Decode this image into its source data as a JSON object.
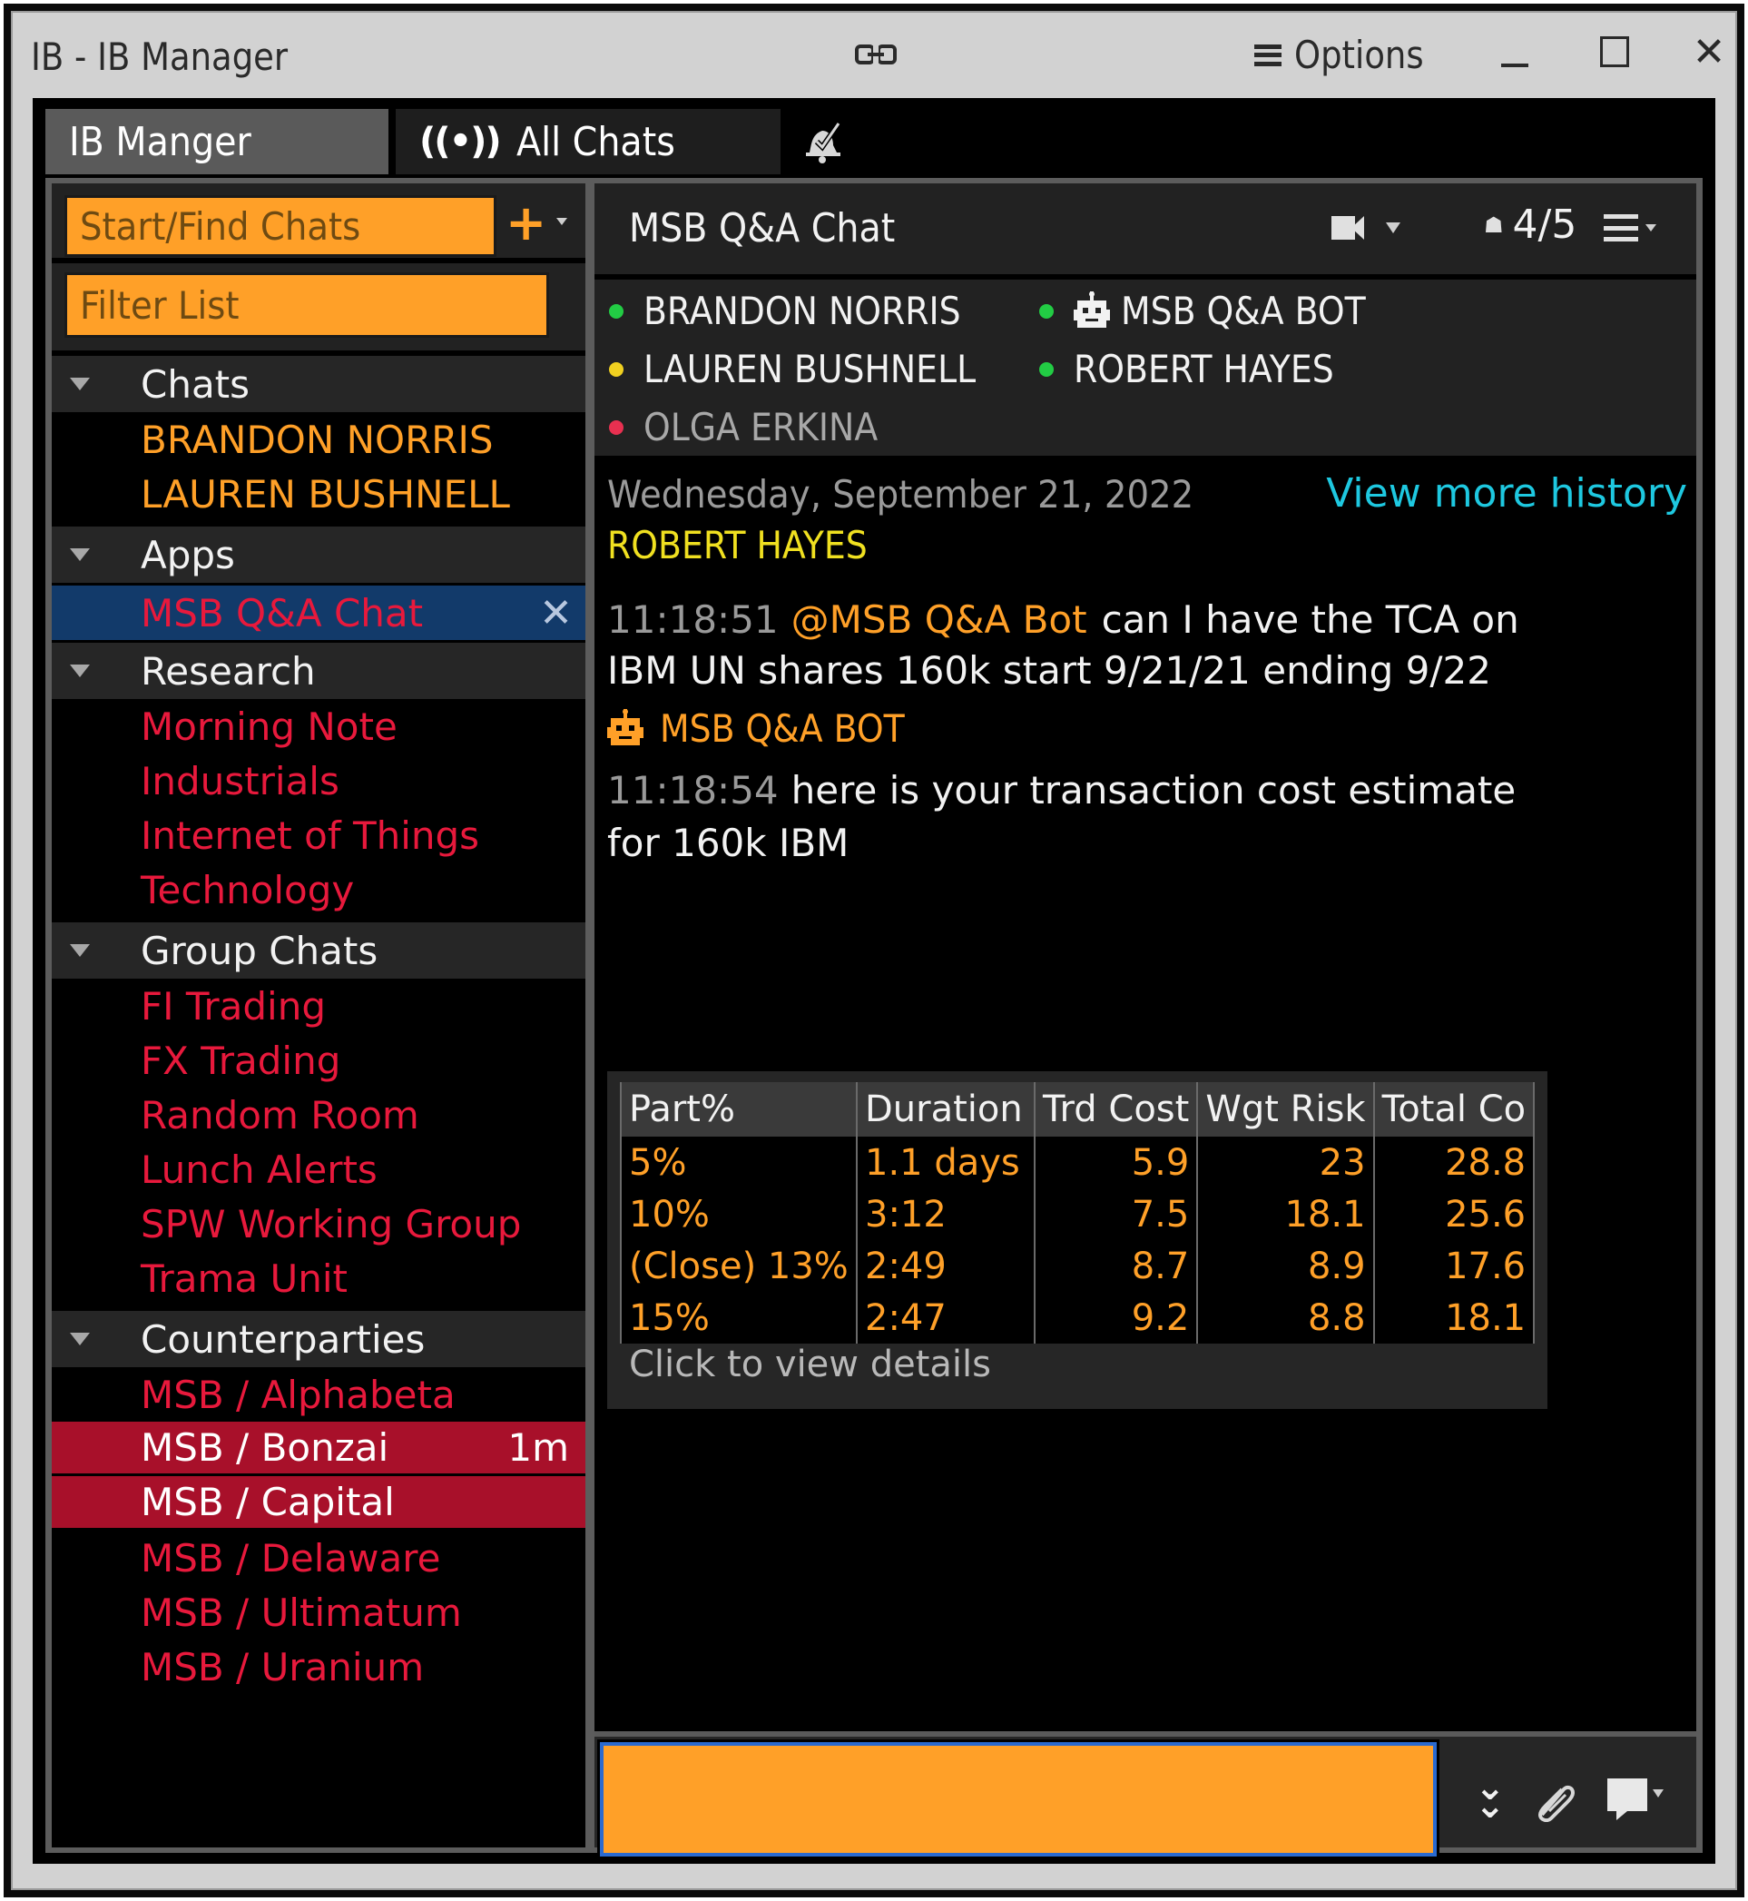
{
  "window": {
    "title": "IB - IB Manager",
    "options_label": "Options",
    "link_icon": "link-icon",
    "minimize_icon": "minimize-icon",
    "maximize_icon": "maximize-icon",
    "close_icon": "close-icon"
  },
  "tabs": [
    {
      "label": "IB Manger",
      "active": true
    },
    {
      "label": "All Chats",
      "icon": "broadcast-icon",
      "icon_glyph": "((•))"
    },
    {
      "label": "",
      "icon": "bell-check-icon"
    }
  ],
  "sidebar": {
    "search_placeholder": "Start/Find Chats",
    "add_label": "+",
    "filter_placeholder": "Filter List",
    "groups": [
      {
        "label": "Chats",
        "items": [
          {
            "label": "BRANDON NORRIS",
            "style": "orange"
          },
          {
            "label": "LAUREN BUSHNELL",
            "style": "orange"
          }
        ]
      },
      {
        "label": "Apps",
        "items": [
          {
            "label": "MSB Q&A Chat",
            "style": "selected",
            "close": "✕"
          }
        ]
      },
      {
        "label": "Research",
        "items": [
          {
            "label": "Morning Note",
            "style": "red"
          },
          {
            "label": "Industrials",
            "style": "red"
          },
          {
            "label": "Internet of Things",
            "style": "red"
          },
          {
            "label": "Technology",
            "style": "red"
          }
        ]
      },
      {
        "label": "Group Chats",
        "items": [
          {
            "label": "FI Trading",
            "style": "red"
          },
          {
            "label": "FX Trading",
            "style": "red"
          },
          {
            "label": "Random Room",
            "style": "red"
          },
          {
            "label": "Lunch Alerts",
            "style": "red"
          },
          {
            "label": "SPW Working Group",
            "style": "red"
          },
          {
            "label": "Trama Unit",
            "style": "red"
          }
        ]
      },
      {
        "label": "Counterparties",
        "items": [
          {
            "label": "MSB / Alphabeta",
            "style": "red"
          },
          {
            "label": "MSB / Bonzai",
            "style": "unread",
            "badge": "1m"
          },
          {
            "label": "MSB / Capital",
            "style": "unread"
          },
          {
            "label": "MSB / Delaware",
            "style": "red"
          },
          {
            "label": "MSB / Ultimatum",
            "style": "red"
          },
          {
            "label": "MSB / Uranium",
            "style": "red"
          }
        ]
      }
    ]
  },
  "chat": {
    "title": "MSB Q&A Chat",
    "members_count": "4/5",
    "participants": [
      {
        "name": "BRANDON NORRIS",
        "status": "online",
        "color": "#22cc44"
      },
      {
        "name": "MSB Q&A BOT",
        "status": "online",
        "color": "#22cc44",
        "bot": true
      },
      {
        "name": "LAUREN BUSHNELL",
        "status": "away",
        "color": "#f0d020"
      },
      {
        "name": "ROBERT HAYES",
        "status": "online",
        "color": "#22cc44"
      },
      {
        "name": "OLGA ERKINA",
        "status": "offline",
        "color": "#e83050"
      }
    ],
    "date": "Wednesday, September 21, 2022",
    "history_link": "View more history",
    "messages": [
      {
        "sender": "ROBERT HAYES",
        "sender_color": "#f0e020",
        "time": "11:18:51",
        "mention": "@MSB Q&A Bot",
        "text_line1": "can I have the TCA on",
        "text_line2": "IBM UN shares 160k start 9/21/21 ending 9/22"
      },
      {
        "sender": "MSB Q&A BOT",
        "sender_color": "#ffa028",
        "time": "11:18:54",
        "text_line1": "here is your transaction cost estimate",
        "text_line2": "for 160k IBM"
      }
    ],
    "tca_table": {
      "headers": [
        "Part%",
        "Duration",
        "Trd Cost",
        "Wgt Risk",
        "Total Co"
      ],
      "rows": [
        [
          "5%",
          "1.1 days",
          "5.9",
          "23",
          "28.8"
        ],
        [
          "10%",
          "3:12",
          "7.5",
          "18.1",
          "25.6"
        ],
        [
          "(Close) 13%",
          "2:49",
          "8.7",
          "8.9",
          "17.6"
        ],
        [
          "15%",
          "2:47",
          "9.2",
          "8.8",
          "18.1"
        ]
      ],
      "details_link": "Click to view details"
    },
    "compose": {
      "value": "",
      "placeholder": ""
    }
  },
  "colors": {
    "accent_orange": "#ffa028",
    "unread_red": "#a8102a",
    "selected_blue": "#123a6a",
    "link_cyan": "#1ec8e0",
    "item_red": "#e8193c"
  }
}
